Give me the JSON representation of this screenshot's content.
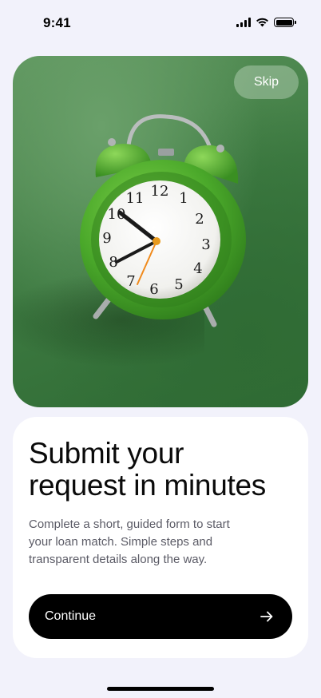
{
  "status_bar": {
    "time": "9:41",
    "icons": [
      "cellular-signal-icon",
      "wifi-icon",
      "battery-icon"
    ]
  },
  "hero": {
    "image": "green-alarm-clock-on-turf",
    "skip_label": "Skip",
    "clock_numbers": [
      "12",
      "1",
      "2",
      "3",
      "4",
      "5",
      "6",
      "7",
      "8",
      "9",
      "10",
      "11"
    ]
  },
  "card": {
    "title_line1": "Submit your",
    "title_line2": "request in minutes",
    "description_line1": "Complete a short, guided form to start",
    "description_line2": "your loan match. Simple steps and",
    "description_line3": "transparent details along the way.",
    "continue_label": "Continue",
    "continue_icon": "arrow-right-icon"
  },
  "colors": {
    "background": "#f2f2fb",
    "button": "#000000",
    "clock_green": "#4caf2e"
  }
}
